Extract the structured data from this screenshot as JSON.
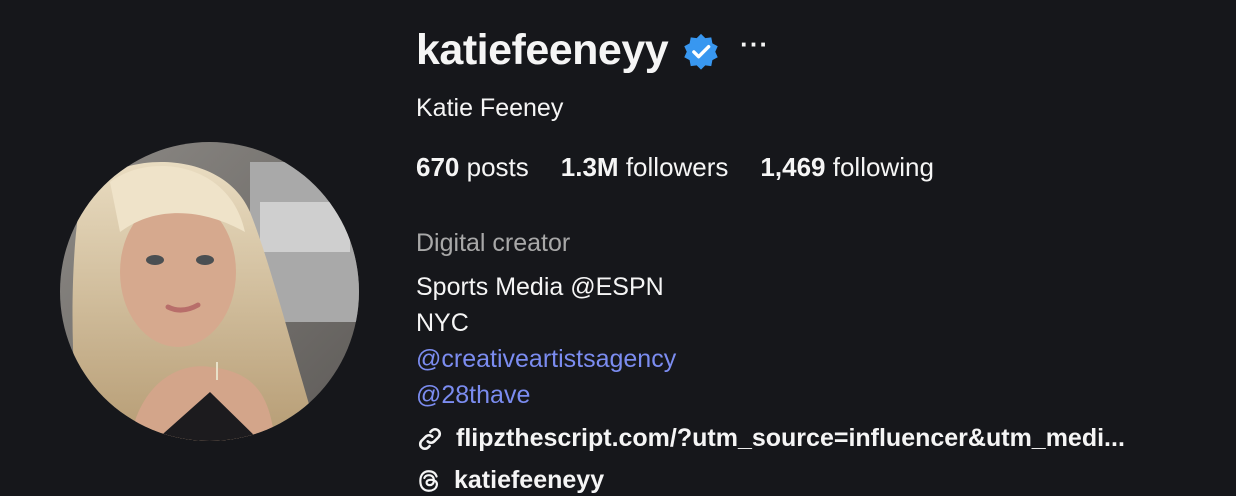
{
  "profile": {
    "username": "katiefeeneyy",
    "more_label": "···",
    "full_name": "Katie Feeney",
    "stats": [
      {
        "value": "670",
        "label": "posts"
      },
      {
        "value": "1.3M",
        "label": "followers"
      },
      {
        "value": "1,469",
        "label": "following"
      }
    ],
    "category": "Digital creator",
    "bio_lines": [
      "Sports Media @ESPN",
      "NYC"
    ],
    "mentions": [
      "@creativeartistsagency",
      "@28thave"
    ],
    "external_link": "flipzthescript.com/?utm_source=influencer&utm_medi...",
    "threads_handle": "katiefeeneyy"
  },
  "colors": {
    "background": "#16171b",
    "text": "#f5f5f5",
    "muted": "#a8a8a8",
    "mention": "#7b8cf0",
    "verified": "#3897f0"
  },
  "icons": {
    "verified": "verified-badge-icon",
    "more": "more-options-icon",
    "link": "link-icon",
    "threads": "threads-icon"
  }
}
